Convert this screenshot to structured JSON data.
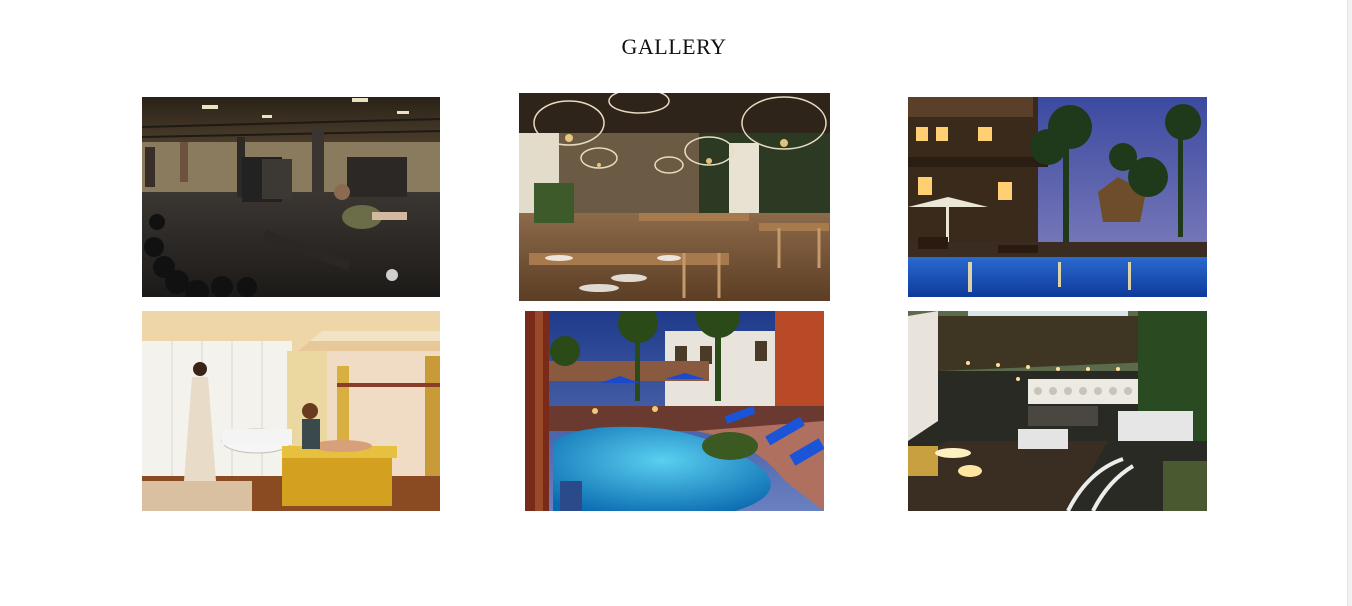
{
  "gallery": {
    "title": "GALLERY",
    "images": [
      {
        "subject": "gym"
      },
      {
        "subject": "restaurant"
      },
      {
        "subject": "resort-pool-night"
      },
      {
        "subject": "spa"
      },
      {
        "subject": "pool"
      },
      {
        "subject": "terrace-lounge"
      }
    ]
  },
  "colors": {
    "background": "#ffffff",
    "title_text": "#111111"
  }
}
